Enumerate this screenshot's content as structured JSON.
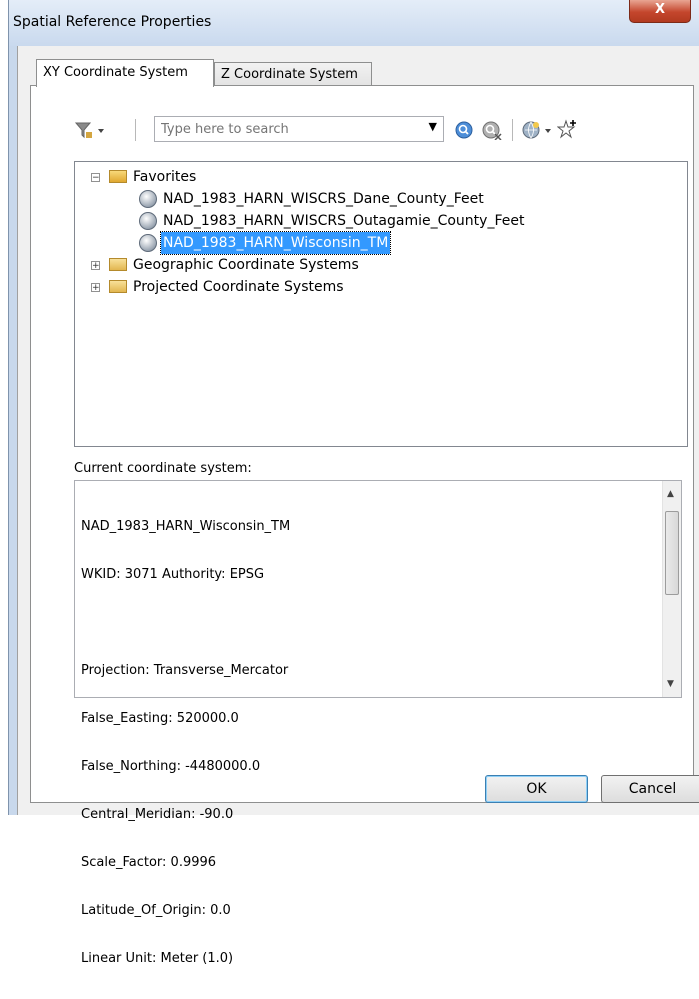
{
  "window": {
    "title": "Spatial Reference Properties",
    "close_glyph": "X"
  },
  "tabs": [
    {
      "label": "XY Coordinate System",
      "active": true
    },
    {
      "label": "Z Coordinate System",
      "active": false
    }
  ],
  "toolbar": {
    "search_placeholder": "Type here to search",
    "icons": [
      "filter-icon",
      "search-icon",
      "clear-search-icon",
      "globe-add-icon",
      "add-favorite-icon"
    ]
  },
  "tree": {
    "favorites": {
      "label": "Favorites",
      "expanded": true,
      "items": [
        {
          "label": "NAD_1983_HARN_WISCRS_Dane_County_Feet",
          "selected": false
        },
        {
          "label": "NAD_1983_HARN_WISCRS_Outagamie_County_Feet",
          "selected": false
        },
        {
          "label": "NAD_1983_HARN_Wisconsin_TM",
          "selected": true
        }
      ]
    },
    "folders": [
      {
        "label": "Geographic Coordinate Systems",
        "expanded": false
      },
      {
        "label": "Projected Coordinate Systems",
        "expanded": false
      }
    ]
  },
  "current": {
    "label": "Current coordinate system:",
    "lines": [
      "NAD_1983_HARN_Wisconsin_TM",
      "WKID: 3071 Authority: EPSG",
      "",
      "Projection: Transverse_Mercator",
      "False_Easting: 520000.0",
      "False_Northing: -4480000.0",
      "Central_Meridian: -90.0",
      "Scale_Factor: 0.9996",
      "Latitude_Of_Origin: 0.0",
      "Linear Unit: Meter (1.0)"
    ]
  },
  "buttons": {
    "ok": "OK",
    "cancel": "Cancel"
  },
  "colors": {
    "selection": "#3399ff",
    "close_button": "#c4462d",
    "titlebar": "#c9d9ee"
  }
}
